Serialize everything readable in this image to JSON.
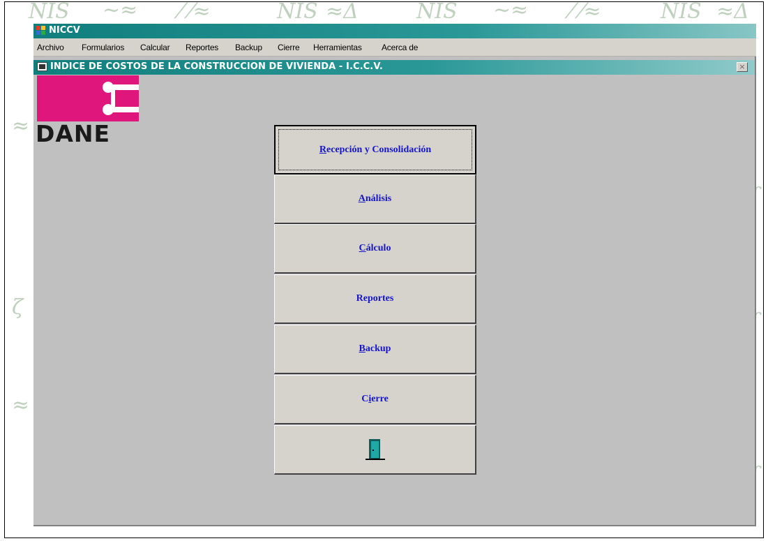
{
  "app": {
    "title": "NICCV"
  },
  "menu": {
    "items": [
      "Archivo",
      "Formularios",
      "Calcular",
      "Reportes",
      "Backup",
      "Cierre",
      "Herramientas",
      "Acerca de"
    ]
  },
  "window": {
    "title": "INDICE DE COSTOS DE LA CONSTRUCCION DE VIVIENDA - I.C.C.V.",
    "close": "×"
  },
  "logo": {
    "text": "DANE",
    "color": "#df167c"
  },
  "buttons": [
    {
      "mn": "R",
      "rest": "ecepción y Consolidación"
    },
    {
      "mn": "A",
      "rest": "nálisis"
    },
    {
      "mn": "C",
      "rest": "álculo"
    },
    {
      "mn": "",
      "rest": "Reportes"
    },
    {
      "mn": "B",
      "rest": "ackup"
    },
    {
      "pre": "C",
      "mn": "i",
      "rest": "erre"
    }
  ],
  "exit_button": {
    "icon": "door-exit-icon"
  },
  "colors": {
    "title_bar": "#0f7e7d",
    "button_text": "#1515c9",
    "button_face": "#d6d3cc",
    "mdi_background": "#c0c0c0"
  }
}
